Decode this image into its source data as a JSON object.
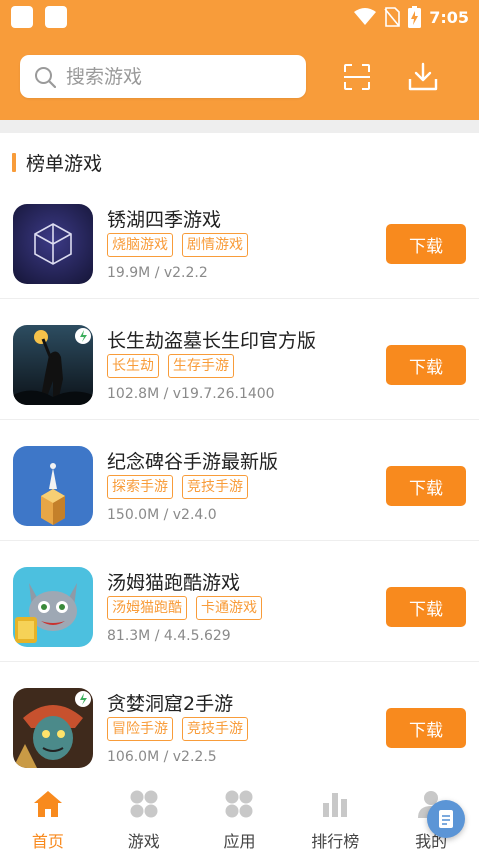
{
  "status_bar": {
    "time": "7:05"
  },
  "search": {
    "placeholder": "搜索游戏"
  },
  "section": {
    "title": "榜单游戏"
  },
  "download_label": "下载",
  "games": [
    {
      "name": "锈湖四季游戏",
      "tags": [
        "烧脑游戏",
        "剧情游戏"
      ],
      "meta": "19.9M / v2.2.2",
      "icon": "rusty-lake-cube-icon"
    },
    {
      "name": "长生劫盗墓长生印官方版",
      "tags": [
        "长生劫",
        "生存手游"
      ],
      "meta": "102.8M / v19.7.26.1400",
      "icon": "explorer-torch-icon"
    },
    {
      "name": "纪念碑谷手游最新版",
      "tags": [
        "探索手游",
        "竞技手游"
      ],
      "meta": "150.0M / v2.4.0",
      "icon": "monument-valley-icon"
    },
    {
      "name": "汤姆猫跑酷游戏",
      "tags": [
        "汤姆猫跑酷",
        "卡通游戏"
      ],
      "meta": "81.3M / 4.4.5.629",
      "icon": "talking-tom-icon"
    },
    {
      "name": "贪婪洞窟2手游",
      "tags": [
        "冒险手游",
        "竞技手游"
      ],
      "meta": "106.0M / v2.2.5",
      "icon": "greedy-cave-icon"
    }
  ],
  "tabs": [
    {
      "label": "首页",
      "icon": "home-icon",
      "active": true
    },
    {
      "label": "游戏",
      "icon": "grid-icon",
      "active": false
    },
    {
      "label": "应用",
      "icon": "apps-grid-icon",
      "active": false
    },
    {
      "label": "排行榜",
      "icon": "bar-chart-icon",
      "active": false
    },
    {
      "label": "我的",
      "icon": "user-icon",
      "active": false
    }
  ],
  "colors": {
    "accent": "#F89C3A",
    "button": "#F88A1E",
    "tab_inactive_icon": "#c8c8c8"
  }
}
